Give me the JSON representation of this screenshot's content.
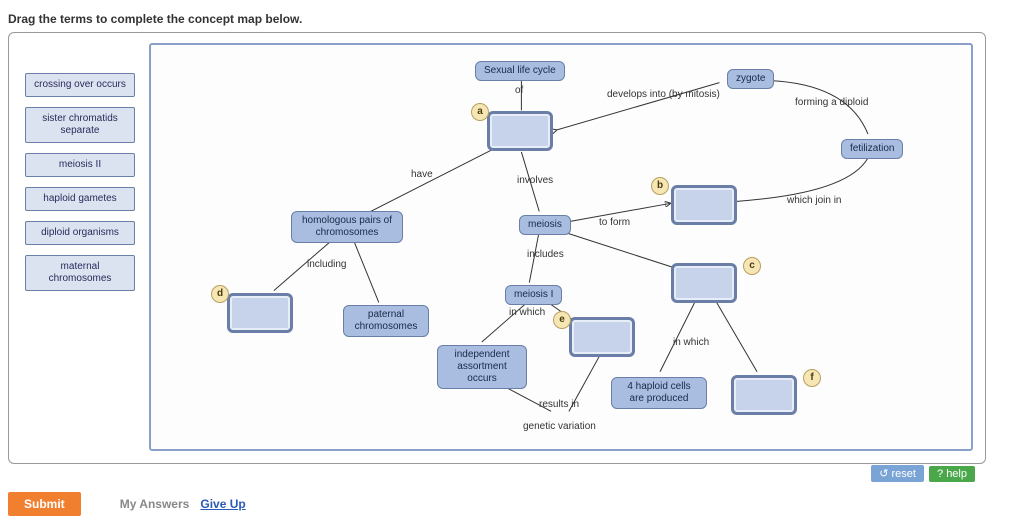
{
  "instruction": "Drag the terms to complete the concept map below.",
  "terms": [
    "crossing over occurs",
    "sister chromatids separate",
    "meiosis II",
    "haploid gametes",
    "diploid organisms",
    "maternal chromosomes"
  ],
  "nodes": {
    "sexual_life": "Sexual life cycle",
    "zygote": "zygote",
    "fertilization": "fetilization",
    "meiosis": "meiosis",
    "homologous": "homologous pairs\nof chromosomes",
    "paternal": "paternal\nchromosomes",
    "meiosis1": "meiosis I",
    "independent": "independent\nassortment\noccurs",
    "haploid4": "4 haploid cells\nare produced",
    "genetic": "genetic variation"
  },
  "edge_labels": {
    "of": "of",
    "develops": "develops into\n(by mitosis)",
    "forming": "forming a diploid",
    "have": "have",
    "involves": "involves",
    "which_join": "which join in",
    "to_form": "to form",
    "including": "including",
    "includes": "includes",
    "in_which1": "in which",
    "in_which2": "in which",
    "results_in": "results in"
  },
  "tags": {
    "a": "a",
    "b": "b",
    "c": "c",
    "d": "d",
    "e": "e",
    "f": "f"
  },
  "buttons": {
    "reset": "reset",
    "help": "? help",
    "submit": "Submit",
    "my_answers": "My Answers",
    "give_up": "Give Up"
  },
  "chart_data": {
    "type": "concept-map",
    "title": "Sexual life cycle concept map (drag-and-drop)",
    "drop_targets": [
      "a",
      "b",
      "c",
      "d",
      "e",
      "f"
    ],
    "draggable_terms": [
      "crossing over occurs",
      "sister chromatids separate",
      "meiosis II",
      "haploid gametes",
      "diploid organisms",
      "maternal chromosomes"
    ],
    "fixed_nodes": [
      "Sexual life cycle",
      "zygote",
      "fetilization",
      "meiosis",
      "homologous pairs of chromosomes",
      "paternal chromosomes",
      "meiosis I",
      "independent assortment occurs",
      "4 haploid cells are produced",
      "genetic variation"
    ],
    "edges": [
      {
        "from": "Sexual life cycle",
        "label": "of",
        "to": "a"
      },
      {
        "from": "a",
        "label": "develops into (by mitosis)",
        "to": "zygote"
      },
      {
        "from": "zygote",
        "label": "forming a diploid",
        "to": "fetilization"
      },
      {
        "from": "fetilization",
        "label": "which join in",
        "to": "b"
      },
      {
        "from": "a",
        "label": "have",
        "to": "homologous pairs of chromosomes"
      },
      {
        "from": "a",
        "label": "involves",
        "to": "meiosis"
      },
      {
        "from": "meiosis",
        "label": "to form",
        "to": "b"
      },
      {
        "from": "homologous pairs of chromosomes",
        "label": "including",
        "to": "d"
      },
      {
        "from": "homologous pairs of chromosomes",
        "label": "including",
        "to": "paternal chromosomes"
      },
      {
        "from": "meiosis",
        "label": "includes",
        "to": "meiosis I"
      },
      {
        "from": "meiosis",
        "label": "includes",
        "to": "c"
      },
      {
        "from": "meiosis I",
        "label": "in which",
        "to": "independent assortment occurs"
      },
      {
        "from": "meiosis I",
        "label": "in which",
        "to": "e"
      },
      {
        "from": "c",
        "label": "in which",
        "to": "4 haploid cells are produced"
      },
      {
        "from": "c",
        "label": "in which",
        "to": "f"
      },
      {
        "from": "independent assortment occurs",
        "label": "results in",
        "to": "genetic variation"
      },
      {
        "from": "e",
        "label": "results in",
        "to": "genetic variation"
      }
    ]
  }
}
